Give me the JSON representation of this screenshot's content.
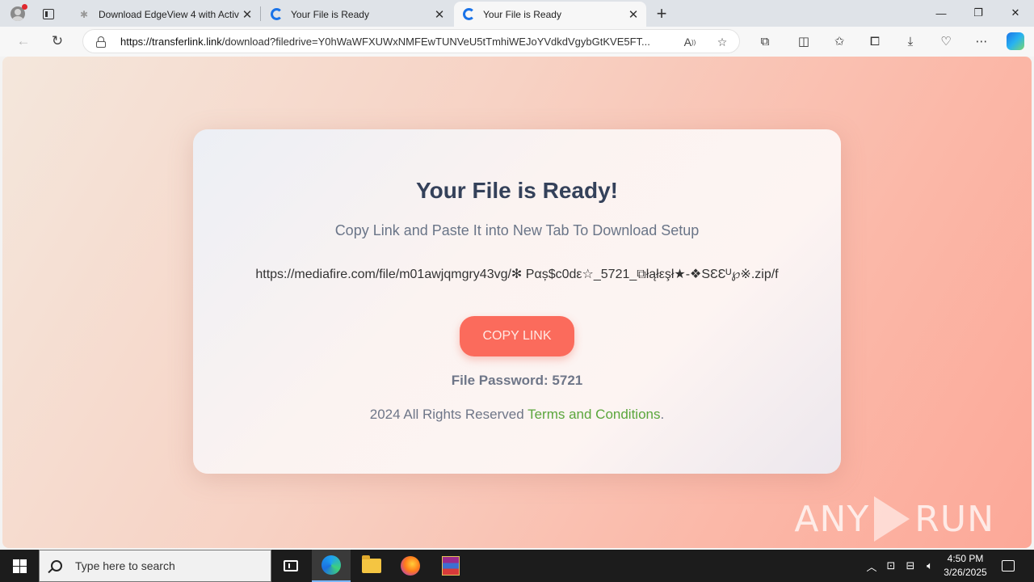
{
  "browser": {
    "tabs": [
      {
        "title": "Download EdgeView 4 with Activ",
        "active": false
      },
      {
        "title": "Your File is Ready",
        "active": false
      },
      {
        "title": "Your File is Ready",
        "active": true
      }
    ],
    "url_host": "https://transferlink.link",
    "url_path": "/download?filedrive=Y0hWaWFXUWxNMFEwTUNVeU5tTmhiWEJoYVdkdVgybGtKVE5FT..."
  },
  "page": {
    "title": "Your File is Ready!",
    "subtitle": "Copy Link and Paste It into New Tab To Download Setup",
    "link": "https://mediafire.com/file/m01awjqmgry43vg/✻ Ραș$c0dε☆_5721_⧉łąłεşł★-❖SƐƐᵁ℘※.zip/f",
    "copy_button": "COPY LINK",
    "password": "File Password: 5721",
    "footer_text": "2024 All Rights Reserved ",
    "footer_link": "Terms and Conditions",
    "footer_end": "."
  },
  "watermark": {
    "left": "ANY",
    "right": "RUN"
  },
  "taskbar": {
    "search_placeholder": "Type here to search",
    "time": "4:50 PM",
    "date": "3/26/2025"
  },
  "colors": {
    "copy_button": "#fb6b5c",
    "terms_link": "#5aa63c",
    "title": "#34415a"
  }
}
